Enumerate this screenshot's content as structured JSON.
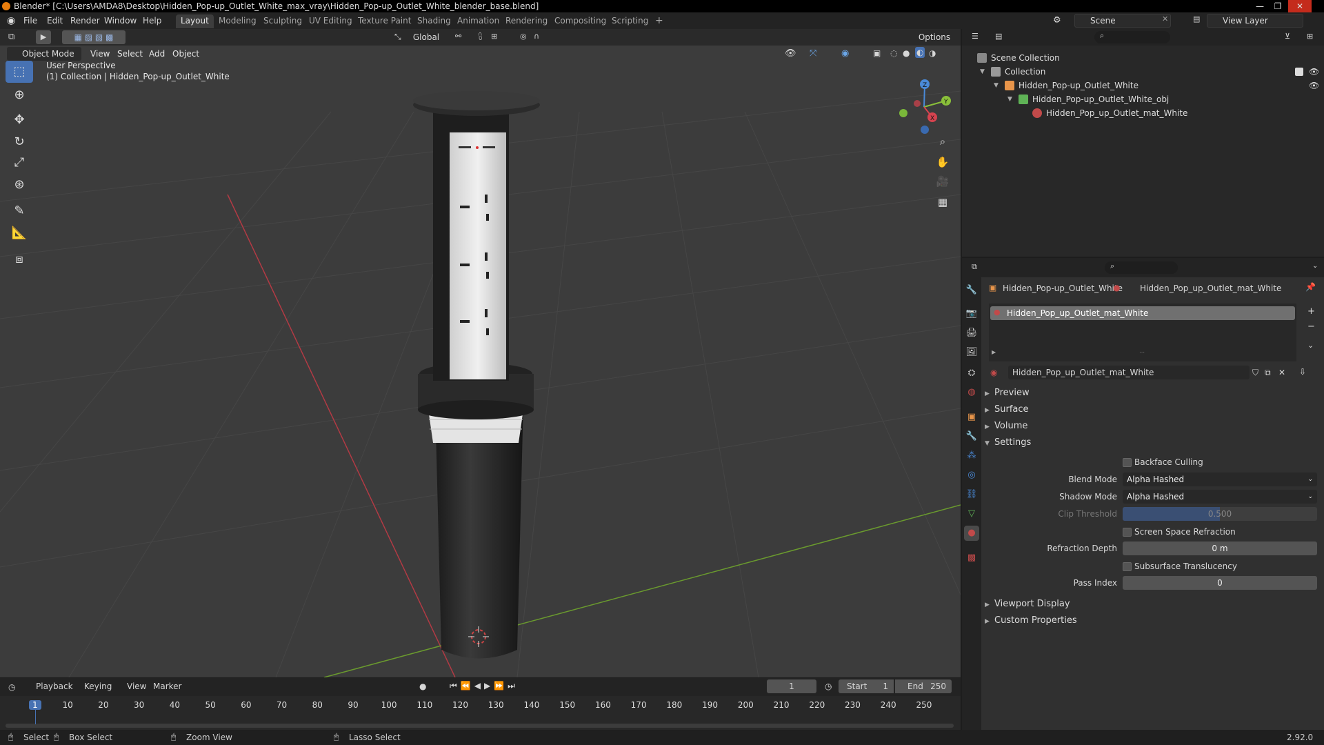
{
  "window": {
    "title": "Blender* [C:\\Users\\AMDA8\\Desktop\\Hidden_Pop-up_Outlet_White_max_vray\\Hidden_Pop-up_Outlet_White_blender_base.blend]",
    "minimize": "—",
    "maximize": "❐",
    "close": "✕"
  },
  "menu": {
    "items": [
      "File",
      "Edit",
      "Render",
      "Window",
      "Help"
    ]
  },
  "workspaces": {
    "tabs": [
      "Layout",
      "Modeling",
      "Sculpting",
      "UV Editing",
      "Texture Paint",
      "Shading",
      "Animation",
      "Rendering",
      "Compositing",
      "Scripting"
    ],
    "active": "Layout",
    "add": "+"
  },
  "scene": {
    "name": "Scene",
    "view_layer": "View Layer"
  },
  "viewport": {
    "mode": "Object Mode",
    "menus": [
      "View",
      "Select",
      "Add",
      "Object"
    ],
    "orientation": "Global",
    "options": "Options",
    "perspective": "User Perspective",
    "collection_info": "(1) Collection | Hidden_Pop-up_Outlet_White",
    "gizmo": {
      "x": "X",
      "y": "Y",
      "z": "Z"
    }
  },
  "outliner": {
    "root": "Scene Collection",
    "collection": "Collection",
    "object": "Hidden_Pop-up_Outlet_White",
    "mesh": "Hidden_Pop-up_Outlet_White_obj",
    "material": "Hidden_Pop_up_Outlet_mat_White"
  },
  "properties": {
    "breadcrumb_object": "Hidden_Pop-up_Outlet_White",
    "breadcrumb_material": "Hidden_Pop_up_Outlet_mat_White",
    "slot": "Hidden_Pop_up_Outlet_mat_White",
    "material_name": "Hidden_Pop_up_Outlet_mat_White",
    "sections": {
      "preview": "Preview",
      "surface": "Surface",
      "volume": "Volume",
      "settings": "Settings",
      "viewport_display": "Viewport Display",
      "custom_properties": "Custom Properties"
    },
    "settings": {
      "backface_culling": "Backface Culling",
      "blend_mode_label": "Blend Mode",
      "blend_mode": "Alpha Hashed",
      "shadow_mode_label": "Shadow Mode",
      "shadow_mode": "Alpha Hashed",
      "clip_threshold_label": "Clip Threshold",
      "clip_threshold": "0.500",
      "clip_threshold_fraction": 0.5,
      "screen_space_refraction": "Screen Space Refraction",
      "refraction_depth_label": "Refraction Depth",
      "refraction_depth": "0 m",
      "subsurface_translucency": "Subsurface Translucency",
      "pass_index_label": "Pass Index",
      "pass_index": "0"
    }
  },
  "timeline": {
    "menus": [
      "Playback",
      "Keying",
      "View",
      "Marker"
    ],
    "current_frame": "1",
    "start_label": "Start",
    "start": "1",
    "end_label": "End",
    "end": "250",
    "ticks": [
      "1",
      "10",
      "20",
      "30",
      "40",
      "50",
      "60",
      "70",
      "80",
      "90",
      "100",
      "110",
      "120",
      "130",
      "140",
      "150",
      "160",
      "170",
      "180",
      "190",
      "200",
      "210",
      "220",
      "230",
      "240",
      "250"
    ]
  },
  "statusbar": {
    "select": "Select",
    "box_select": "Box Select",
    "zoom_view": "Zoom View",
    "lasso_select": "Lasso Select",
    "version": "2.92.0"
  },
  "colors": {
    "accent": "#4772b3",
    "active_tab": "#3d3d3d",
    "viewport_bg": "#3c3c3c",
    "x_axis": "#d6434f",
    "y_axis": "#8ac03a",
    "z_axis": "#4a8ad8"
  }
}
